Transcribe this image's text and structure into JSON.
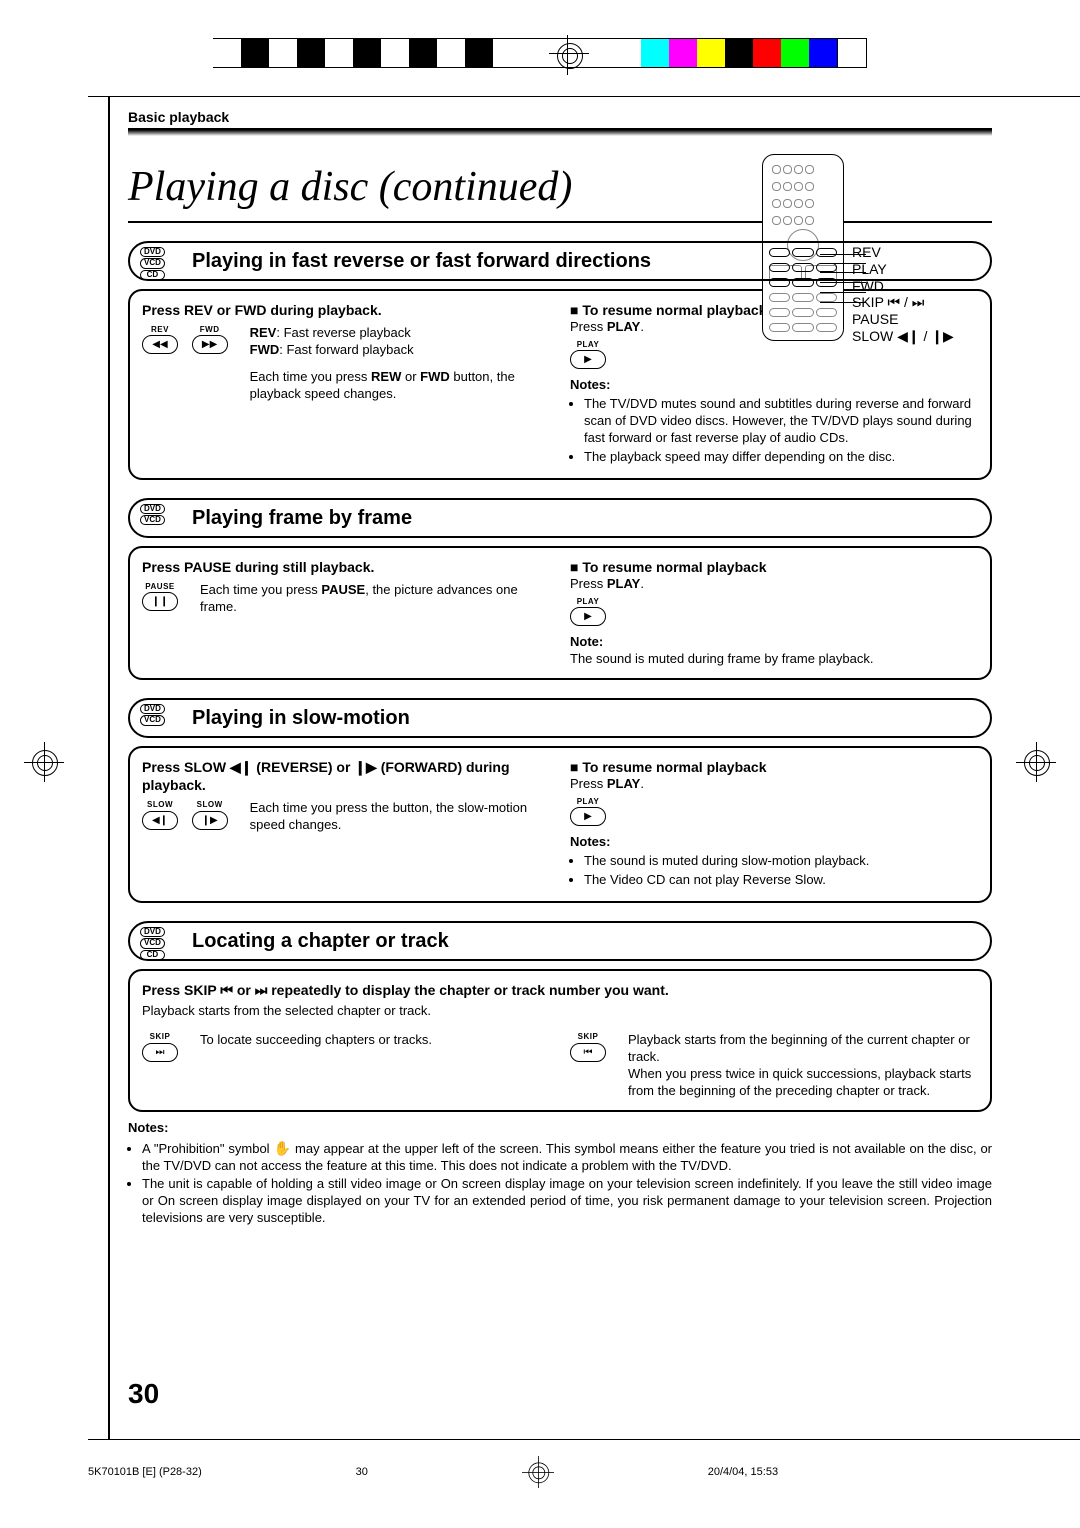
{
  "meta": {
    "doc_id": "5K70101B [E] (P28-32)",
    "print_page": "30",
    "timestamp": "20/4/04, 15:53"
  },
  "header": {
    "section": "Basic playback",
    "title": "Playing a disc (continued)"
  },
  "page_number": "30",
  "remote_callouts": [
    "REV",
    "PLAY",
    "FWD",
    "SKIP ⏮ / ⏭",
    "PAUSE",
    "SLOW ◀❙ / ❙▶"
  ],
  "sections": {
    "fastrevfwd": {
      "badges": [
        "DVD",
        "VCD",
        "CD"
      ],
      "heading": "Playing in fast reverse or fast forward directions",
      "left_title": "Press REV or FWD during playback.",
      "rev_label": "REV",
      "fwd_label": "FWD",
      "rev_desc": ": Fast reverse playback",
      "fwd_desc": ": Fast forward playback",
      "body": "Each time you press REW or FWD button, the playback speed changes.",
      "right_title": "To resume normal playback",
      "right_body": "Press PLAY.",
      "play_label": "PLAY",
      "notes_label": "Notes:",
      "notes": [
        "The TV/DVD mutes sound and subtitles during reverse and forward scan of DVD video discs. However, the TV/DVD plays sound during fast forward or fast reverse play of audio CDs.",
        "The playback speed may differ depending on the disc."
      ]
    },
    "frame": {
      "badges": [
        "DVD",
        "VCD"
      ],
      "heading": "Playing frame by frame",
      "left_title": "Press PAUSE during still playback.",
      "pause_label": "PAUSE",
      "body": "Each time you press PAUSE, the picture advances one frame.",
      "right_title": "To resume normal playback",
      "right_body": "Press PLAY.",
      "play_label": "PLAY",
      "notes_label": "Note:",
      "note": "The sound is muted during frame by frame playback."
    },
    "slow": {
      "badges": [
        "DVD",
        "VCD"
      ],
      "heading": "Playing in slow-motion",
      "left_title": "Press SLOW ◀❙ (REVERSE) or ❙▶ (FORWARD) during playback.",
      "slow_label": "SLOW",
      "body": "Each time you press the button, the slow-motion speed changes.",
      "right_title": "To resume normal playback",
      "right_body": "Press PLAY.",
      "play_label": "PLAY",
      "notes_label": "Notes:",
      "notes": [
        "The sound is muted during slow-motion playback.",
        "The Video CD can not play Reverse Slow."
      ]
    },
    "locate": {
      "badges": [
        "DVD",
        "VCD",
        "CD"
      ],
      "heading": "Locating a chapter or track",
      "top_line": "Press SKIP ⏮ or ⏭ repeatedly to display the chapter or track number you want.",
      "sub_line": "Playback starts from the selected chapter or track.",
      "skip_label": "SKIP",
      "fwd_desc": "To locate succeeding chapters or tracks.",
      "back_desc1": "Playback starts from the beginning of the current chapter or track.",
      "back_desc2": "When you press twice in quick successions, playback starts from the beginning of the preceding chapter or track."
    },
    "bottom_notes": {
      "label": "Notes:",
      "items": [
        "A \"Prohibition\" symbol ✋ may appear at the upper left of the screen. This symbol means either the feature you tried is not available on the disc, or the TV/DVD can not access the feature at this time. This does not indicate a problem with the TV/DVD.",
        "The unit is capable of holding a still video image or On screen display image on your television screen indefinitely. If you leave the still video image or On screen display image displayed on your TV for an extended period of time, you risk permanent damage to your television screen. Projection televisions are very susceptible."
      ]
    }
  }
}
